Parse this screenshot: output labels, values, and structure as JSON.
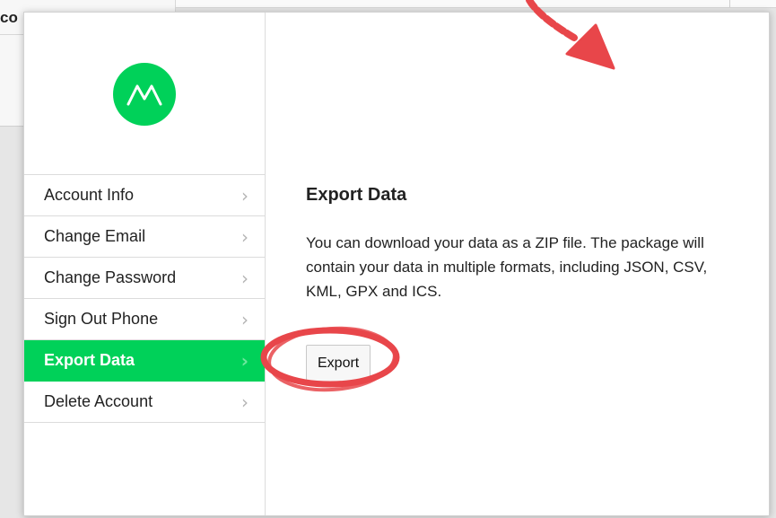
{
  "background": {
    "partial_text": "co"
  },
  "sidebar": {
    "items": [
      {
        "label": "Account Info",
        "active": false
      },
      {
        "label": "Change Email",
        "active": false
      },
      {
        "label": "Change Password",
        "active": false
      },
      {
        "label": "Sign Out Phone",
        "active": false
      },
      {
        "label": "Export Data",
        "active": true
      },
      {
        "label": "Delete Account",
        "active": false
      }
    ],
    "chevron": "›"
  },
  "content": {
    "title": "Export Data",
    "description": "You can download your data as a ZIP file. The package will contain your data in multiple formats, including JSON, CSV, KML, GPX and ICS.",
    "export_label": "Export"
  },
  "colors": {
    "accent": "#00d159",
    "annotation": "#e8464a"
  },
  "icons": {
    "logo": "moves-logo-icon",
    "chevron": "chevron-right-icon"
  }
}
